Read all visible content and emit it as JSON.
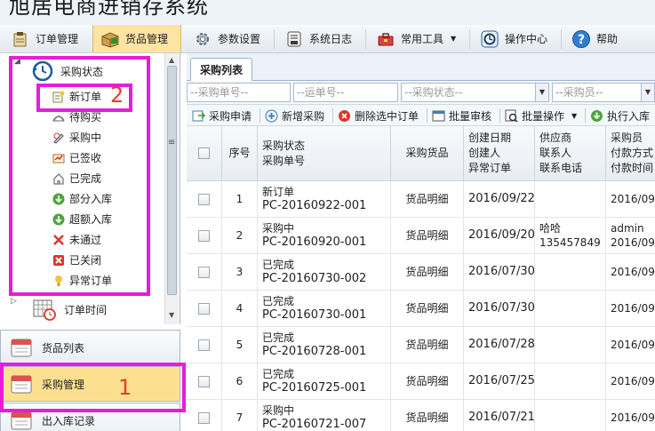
{
  "app": {
    "title": "旭居电商进销存系统"
  },
  "menu": [
    {
      "label": "订单管理",
      "icon": "order-icon"
    },
    {
      "label": "货品管理",
      "icon": "goods-box-icon",
      "active": true
    },
    {
      "label": "参数设置",
      "icon": "settings-icon"
    },
    {
      "label": "系统日志",
      "icon": "log-icon"
    },
    {
      "label": "常用工具",
      "icon": "toolbox-icon",
      "has_dropdown": true
    },
    {
      "label": "操作中心",
      "icon": "operation-center-icon"
    },
    {
      "label": "帮助",
      "icon": "help-icon"
    }
  ],
  "tree": {
    "root_label": "采购状态",
    "children": [
      {
        "label": "新订单",
        "icon": "new-order-icon"
      },
      {
        "label": "待购买",
        "icon": "pending-buy-icon"
      },
      {
        "label": "采购中",
        "icon": "purchasing-icon"
      },
      {
        "label": "已签收",
        "icon": "signed-icon"
      },
      {
        "label": "已完成",
        "icon": "completed-icon"
      },
      {
        "label": "部分入库",
        "icon": "partial-stock-in-icon"
      },
      {
        "label": "超额入库",
        "icon": "excess-stock-in-icon"
      },
      {
        "label": "未通过",
        "icon": "rejected-icon"
      },
      {
        "label": "已关闭",
        "icon": "closed-icon"
      },
      {
        "label": "异常订单",
        "icon": "abnormal-order-icon"
      }
    ],
    "sibling_label": "订单时间"
  },
  "accordion": [
    {
      "label": "货品列表"
    },
    {
      "label": "采购管理",
      "selected": true
    },
    {
      "label": "出入库记录"
    }
  ],
  "annotations": {
    "one": "1",
    "two": "2"
  },
  "tab": {
    "label": "采购列表"
  },
  "filters": {
    "purchase_no": "--采购单号--",
    "waybill_no": "--运单号--",
    "status": "--采购状态--",
    "buyer": "--采购员--"
  },
  "toolbar": [
    {
      "label": "采购申请",
      "icon": "apply-icon"
    },
    {
      "label": "新增采购",
      "icon": "add-icon"
    },
    {
      "label": "删除选中订单",
      "icon": "delete-icon"
    },
    {
      "label": "批量审核",
      "icon": "batch-review-icon"
    },
    {
      "label": "批量操作",
      "icon": "batch-operation-icon",
      "has_dropdown": true
    },
    {
      "label": "执行入库",
      "icon": "stock-in-icon"
    }
  ],
  "grid": {
    "headers": {
      "seq": "序号",
      "status_lines": [
        "采购状态",
        "采购单号"
      ],
      "goods": "采购货品",
      "created_lines": [
        "创建日期",
        "创建人",
        "异常订单"
      ],
      "supplier_lines": [
        "供应商",
        "联系人",
        "联系电话"
      ],
      "buyer_lines": [
        "采购员",
        "付款方式",
        "付款时间"
      ]
    },
    "rows": [
      {
        "seq": "1",
        "status": "新订单",
        "order_no": "PC-20160922-001",
        "goods": "货品明细",
        "created_date": "2016/09/22",
        "supplier_line1": "",
        "supplier_line2": "",
        "buyer_line1": "2016/09",
        "buyer_line2": ""
      },
      {
        "seq": "2",
        "status": "采购中",
        "order_no": "PC-20160920-001",
        "goods": "货品明细",
        "created_date": "2016/09/20",
        "supplier_line1": "哈哈",
        "supplier_line2": "135457849",
        "buyer_line1": "admin",
        "buyer_line2": "2016/09"
      },
      {
        "seq": "3",
        "status": "已完成",
        "order_no": "PC-20160730-002",
        "goods": "货品明细",
        "created_date": "2016/07/30",
        "supplier_line1": "",
        "supplier_line2": "",
        "buyer_line1": "2016/09",
        "buyer_line2": ""
      },
      {
        "seq": "4",
        "status": "已完成",
        "order_no": "PC-20160730-001",
        "goods": "货品明细",
        "created_date": "2016/07/30",
        "supplier_line1": "",
        "supplier_line2": "",
        "buyer_line1": "2016/09",
        "buyer_line2": ""
      },
      {
        "seq": "5",
        "status": "已完成",
        "order_no": "PC-20160728-001",
        "goods": "货品明细",
        "created_date": "2016/07/28",
        "supplier_line1": "",
        "supplier_line2": "",
        "buyer_line1": "2016/09",
        "buyer_line2": ""
      },
      {
        "seq": "6",
        "status": "已完成",
        "order_no": "PC-20160725-001",
        "goods": "货品明细",
        "created_date": "2016/07/25",
        "supplier_line1": "",
        "supplier_line2": "",
        "buyer_line1": "2016/09",
        "buyer_line2": ""
      },
      {
        "seq": "7",
        "status": "采购中",
        "order_no": "PC-20160721-007",
        "goods": "货品明细",
        "created_date": "2016/07/21",
        "supplier_line1": "",
        "supplier_line2": "",
        "buyer_line1": "2016/09",
        "buyer_line2": ""
      }
    ]
  }
}
